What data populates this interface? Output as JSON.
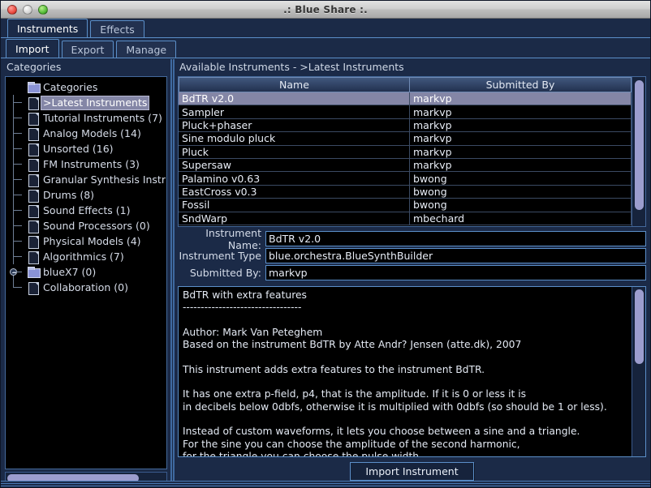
{
  "window": {
    "title": ".: Blue Share :.",
    "controls": [
      "close-button",
      "minimize-button",
      "zoom-button"
    ]
  },
  "main_tabs": [
    {
      "label": "Instruments",
      "active": true
    },
    {
      "label": "Effects",
      "active": false
    }
  ],
  "sub_tabs": [
    {
      "label": "Import",
      "active": true
    },
    {
      "label": "Export",
      "active": false
    },
    {
      "label": "Manage",
      "active": false
    }
  ],
  "sidebar": {
    "header": "Categories",
    "root": "Categories",
    "items": [
      {
        "label": ">Latest Instruments",
        "icon": "file-icon",
        "selected": true,
        "handle": false
      },
      {
        "label": "Tutorial Instruments (7)",
        "icon": "file-icon",
        "selected": false,
        "handle": false
      },
      {
        "label": "Analog Models (14)",
        "icon": "file-icon",
        "selected": false,
        "handle": false
      },
      {
        "label": "Unsorted (16)",
        "icon": "file-icon",
        "selected": false,
        "handle": false
      },
      {
        "label": "FM Instruments (3)",
        "icon": "file-icon",
        "selected": false,
        "handle": false
      },
      {
        "label": "Granular Synthesis Instrum",
        "icon": "file-icon",
        "selected": false,
        "handle": false
      },
      {
        "label": "Drums (8)",
        "icon": "file-icon",
        "selected": false,
        "handle": false
      },
      {
        "label": "Sound Effects (1)",
        "icon": "file-icon",
        "selected": false,
        "handle": false
      },
      {
        "label": "Sound Processors (0)",
        "icon": "file-icon",
        "selected": false,
        "handle": false
      },
      {
        "label": "Physical Models (4)",
        "icon": "file-icon",
        "selected": false,
        "handle": false
      },
      {
        "label": "Algorithmics (7)",
        "icon": "file-icon",
        "selected": false,
        "handle": false
      },
      {
        "label": "blueX7 (0)",
        "icon": "folder-icon",
        "selected": false,
        "handle": true
      },
      {
        "label": "Collaboration (0)",
        "icon": "file-icon",
        "selected": false,
        "handle": false
      }
    ]
  },
  "instruments_panel": {
    "header": "Available Instruments - >Latest Instruments",
    "columns": [
      "Name",
      "Submitted By"
    ],
    "rows": [
      {
        "name": "BdTR v2.0",
        "submitted_by": "markvp",
        "selected": true
      },
      {
        "name": "Sampler",
        "submitted_by": "markvp",
        "selected": false
      },
      {
        "name": "Pluck+phaser",
        "submitted_by": "markvp",
        "selected": false
      },
      {
        "name": "Sine modulo pluck",
        "submitted_by": "markvp",
        "selected": false
      },
      {
        "name": "Pluck",
        "submitted_by": "markvp",
        "selected": false
      },
      {
        "name": "Supersaw",
        "submitted_by": "markvp",
        "selected": false
      },
      {
        "name": "Palamino v0.63",
        "submitted_by": "bwong",
        "selected": false
      },
      {
        "name": "EastCross v0.3",
        "submitted_by": "bwong",
        "selected": false
      },
      {
        "name": "Fossil",
        "submitted_by": "bwong",
        "selected": false
      },
      {
        "name": "SndWarp",
        "submitted_by": "mbechard",
        "selected": false
      }
    ]
  },
  "details": {
    "name_label": "Instrument Name:",
    "name_value": "BdTR v2.0",
    "type_label": "Instrument Type",
    "type_value": "blue.orchestra.BlueSynthBuilder",
    "submitted_label": "Submitted By:",
    "submitted_value": "markvp",
    "description": "BdTR with extra features\n---------------------------------\n\nAuthor: Mark Van Peteghem\nBased on the instrument BdTR by Atte Andr? Jensen (atte.dk), 2007\n\nThis instrument adds extra features to the instrument BdTR.\n\nIt has one extra p-field, p4, that is the amplitude. If it is 0 or less it is\nin decibels below 0dbfs, otherwise it is multiplied with 0dbfs (so should be 1 or less).\n\nInstead of custom waveforms, it lets you choose between a sine and a triangle.\nFor the sine you can choose the amplitude of the second harmonic,\nfor the triangle you can choose the pulse width."
  },
  "footer": {
    "import_label": "Import Instrument"
  },
  "colors": {
    "window_bg": "#1b2a47",
    "accent_border": "#5b8fc9",
    "content_bg": "#000000",
    "selection": "#8486a6",
    "scroll_thumb": "#9c9dce",
    "text": "#e4eaf4"
  }
}
